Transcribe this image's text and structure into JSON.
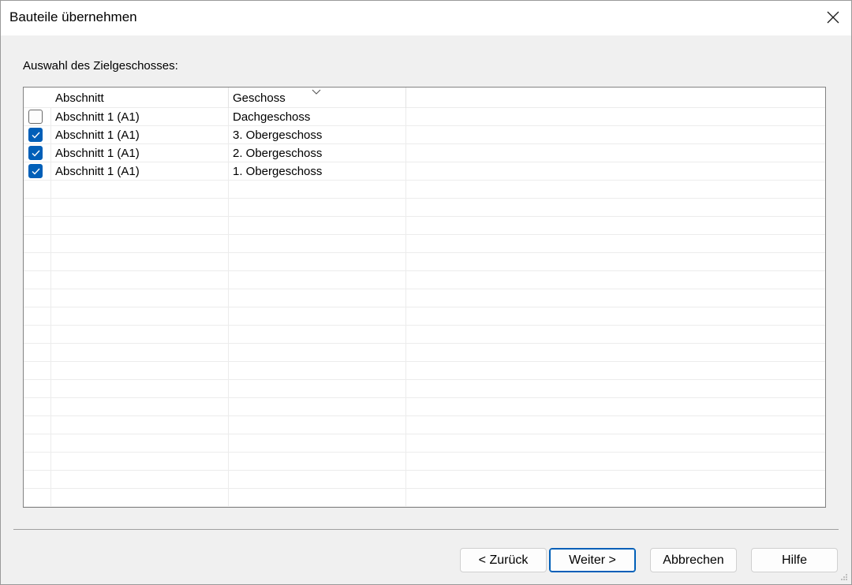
{
  "window": {
    "title": "Bauteile übernehmen"
  },
  "section_label": "Auswahl des Zielgeschosses:",
  "grid": {
    "columns": [
      {
        "label": ""
      },
      {
        "label": "Abschnitt"
      },
      {
        "label": "Geschoss"
      }
    ],
    "rows": [
      {
        "checked": false,
        "abschnitt": "Abschnitt 1 (A1)",
        "geschoss": "Dachgeschoss"
      },
      {
        "checked": true,
        "abschnitt": "Abschnitt 1 (A1)",
        "geschoss": "3. Obergeschoss"
      },
      {
        "checked": true,
        "abschnitt": "Abschnitt 1 (A1)",
        "geschoss": "2. Obergeschoss"
      },
      {
        "checked": true,
        "abschnitt": "Abschnitt 1 (A1)",
        "geschoss": "1. Obergeschoss"
      }
    ]
  },
  "buttons": {
    "back": "< Zurück",
    "next": "Weiter >",
    "cancel": "Abbrechen",
    "help": "Hilfe"
  },
  "colors": {
    "accent": "#005fb8"
  },
  "icons": {
    "close": "close-icon",
    "sort": "chevron-down-icon",
    "check": "checkmark-icon",
    "grip": "resize-grip-icon"
  }
}
